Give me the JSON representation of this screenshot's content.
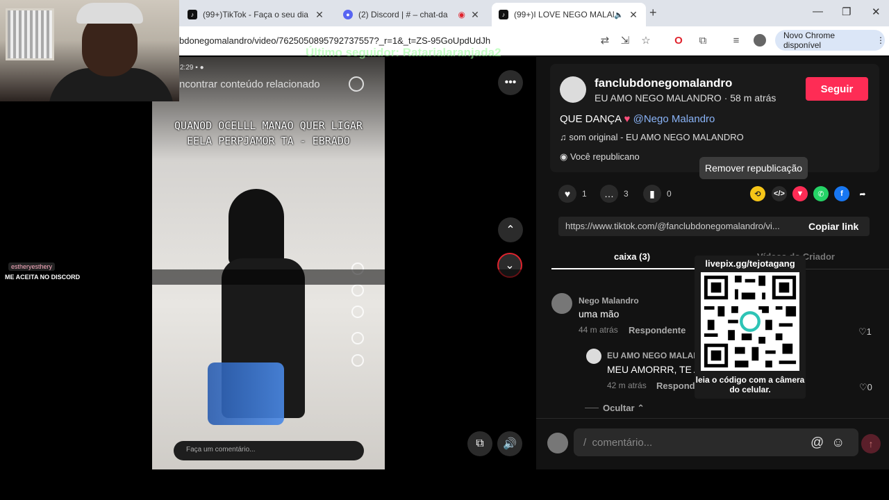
{
  "browser": {
    "tabs": [
      {
        "title": "(99+)TikTok - Faça o seu dia",
        "favicon": "tiktok-icon"
      },
      {
        "title": "(2) Discord | # – chat-da",
        "favicon": "discord-icon"
      },
      {
        "title": "(99+)I LOVE NEGO MALANI",
        "favicon": "tiktok-icon"
      }
    ],
    "url": "bdonegomalandro/video/7625050895792737557?_r=1&_t=ZS-95GoUpdUdJh",
    "update_label": "Novo Chrome disponível"
  },
  "stream_overlay": {
    "last_follower": "Último seguidor: Ratarialaranjada2",
    "chat_user": "estheryesthery",
    "chat_message": "ME ACEITA NO DISCORD"
  },
  "video": {
    "search_text": "ncontrar conteúdo relacionado",
    "caption_text": "QUANOD OCELLL MANAO QUER LIGAR\nEELA PERPJAMOR TA - EBRADO",
    "comment_placeholder": "Faça um comentário..."
  },
  "post": {
    "author": "fanclubdonegomalandro",
    "subtitle": "EU AMO NEGO MALANDRO · 58 m atrás",
    "follow_label": "Seguir",
    "description_prefix": "QUE DANÇA",
    "mention": "@Nego Malandro",
    "sound": "som original - EU AMO NEGO MALANDRO",
    "repost_status": "Você republicano",
    "tooltip": "Remover republicação",
    "likes": "1",
    "comments": "3",
    "saves": "0",
    "link": "https://www.tiktok.com/@fanclubdonegomalandro/vi...",
    "copy_label": "Copiar link"
  },
  "comment_tabs": {
    "comments": "caixa (3)",
    "creator": "Vídeos do Criador"
  },
  "comments": [
    {
      "author": "Nego Malandro",
      "text": "uma mão",
      "time": "44 m atrás",
      "reply": "Respondente",
      "likes": "1"
    },
    {
      "author": "EU AMO NEGO MALAI",
      "text": "MEU AMORRR, TE A",
      "time": "42 m atrás",
      "reply": "Respond",
      "likes": "0"
    }
  ],
  "hide_label": "Ocultar",
  "comment_input_placeholder": "/  comentário...",
  "qr_overlay": {
    "title": "livepix.gg/tejotagang",
    "note": "leia o código com a câmera do celular."
  },
  "colors": {
    "accent": "#fe2c55",
    "panel_bg": "#121212",
    "link": "#8ab4f8"
  }
}
